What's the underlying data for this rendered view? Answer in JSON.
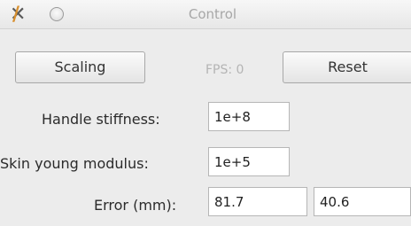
{
  "window": {
    "title": "Control",
    "close_icon": "close-x-icon",
    "minimize_icon": "minimize-circle-icon"
  },
  "toolbar": {
    "scaling_label": "Scaling",
    "fps_text": "FPS: 0",
    "reset_label": "Reset"
  },
  "form": {
    "handle_stiffness": {
      "label": "Handle stiffness:",
      "value": "1e+8"
    },
    "skin_young_modulus": {
      "label": "Skin young modulus:",
      "value": "1e+5"
    },
    "error": {
      "label": "Error (mm):",
      "value1": "81.7",
      "value2": "40.6"
    }
  }
}
